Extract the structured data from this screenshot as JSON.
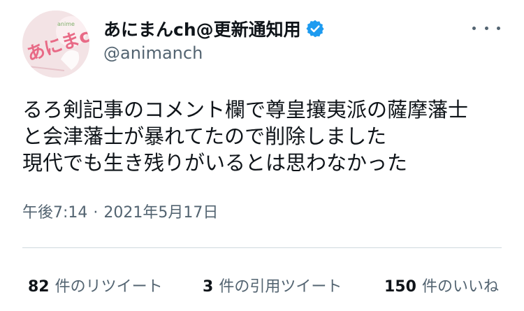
{
  "account": {
    "display_name": "あにまんch@更新通知用",
    "handle": "@animanch",
    "avatar_text": "あにまんch",
    "verified_icon": "verified-badge-icon",
    "more_icon": "more-horizontal-icon"
  },
  "tweet": {
    "lines": [
      "るろ剣記事のコメント欄で尊皇攘夷派の薩摩藩士",
      "と会津藩士が暴れてたので削除しました",
      "現代でも生き残りがいるとは思わなかった"
    ],
    "time": "午後7:14",
    "separator": "·",
    "date": "2021年5月17日"
  },
  "stats": {
    "retweets_count": "82",
    "retweets_label": "件のリツイート",
    "quotes_count": "3",
    "quotes_label": "件の引用ツイート",
    "likes_count": "150",
    "likes_label": "件のいいね"
  },
  "colors": {
    "text": "#0f1419",
    "secondary": "#536471",
    "verified": "#1d9bf0",
    "divider": "#cfd9de"
  }
}
